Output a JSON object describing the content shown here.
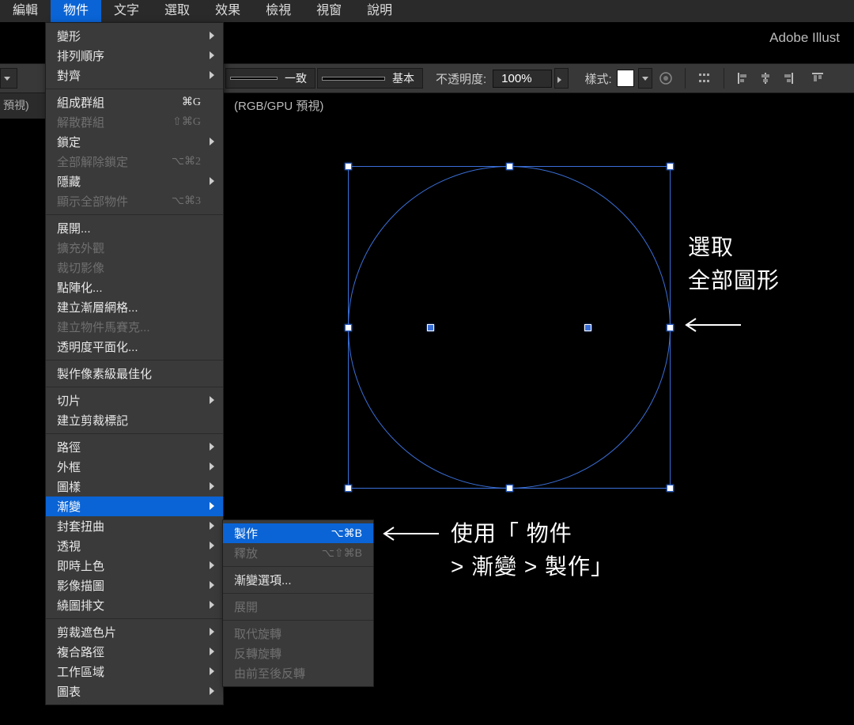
{
  "app_name": "Adobe Illust",
  "menubar": [
    "編輯",
    "物件",
    "文字",
    "選取",
    "效果",
    "檢視",
    "視窗",
    "說明"
  ],
  "menubar_active_index": 1,
  "controlbar": {
    "stroke_style_label_1": "一致",
    "stroke_style_label_2": "基本",
    "opacity_label": "不透明度:",
    "opacity_value": "100%",
    "style_label": "樣式:"
  },
  "tab_stub": "預視)",
  "doc_tab_suffix": "(RGB/GPU 預視)",
  "object_menu": {
    "groups": [
      [
        {
          "label": "變形",
          "arrow": true
        },
        {
          "label": "排列順序",
          "arrow": true
        },
        {
          "label": "對齊",
          "arrow": true
        }
      ],
      [
        {
          "label": "組成群組",
          "shortcut": "⌘G"
        },
        {
          "label": "解散群組",
          "shortcut": "⇧⌘G",
          "disabled": true
        },
        {
          "label": "鎖定",
          "arrow": true
        },
        {
          "label": "全部解除鎖定",
          "shortcut": "⌥⌘2",
          "disabled": true
        },
        {
          "label": "隱藏",
          "arrow": true
        },
        {
          "label": "顯示全部物件",
          "shortcut": "⌥⌘3",
          "disabled": true
        }
      ],
      [
        {
          "label": "展開..."
        },
        {
          "label": "擴充外觀",
          "disabled": true
        },
        {
          "label": "裁切影像",
          "disabled": true
        },
        {
          "label": "點陣化..."
        },
        {
          "label": "建立漸層網格..."
        },
        {
          "label": "建立物件馬賽克...",
          "disabled": true
        },
        {
          "label": "透明度平面化..."
        }
      ],
      [
        {
          "label": "製作像素級最佳化"
        }
      ],
      [
        {
          "label": "切片",
          "arrow": true
        },
        {
          "label": "建立剪裁標記"
        }
      ],
      [
        {
          "label": "路徑",
          "arrow": true
        },
        {
          "label": "外框",
          "arrow": true
        },
        {
          "label": "圖樣",
          "arrow": true
        },
        {
          "label": "漸變",
          "arrow": true,
          "highlight": true
        },
        {
          "label": "封套扭曲",
          "arrow": true
        },
        {
          "label": "透視",
          "arrow": true
        },
        {
          "label": "即時上色",
          "arrow": true
        },
        {
          "label": "影像描圖",
          "arrow": true
        },
        {
          "label": "繞圖排文",
          "arrow": true
        }
      ],
      [
        {
          "label": "剪裁遮色片",
          "arrow": true
        },
        {
          "label": "複合路徑",
          "arrow": true
        },
        {
          "label": "工作區域",
          "arrow": true
        },
        {
          "label": "圖表",
          "arrow": true
        }
      ]
    ]
  },
  "blend_submenu": [
    {
      "label": "製作",
      "shortcut": "⌥⌘B",
      "highlight": true
    },
    {
      "label": "釋放",
      "shortcut": "⌥⇧⌘B",
      "disabled": true
    },
    {
      "sep": true
    },
    {
      "label": "漸變選項..."
    },
    {
      "sep": true
    },
    {
      "label": "展開",
      "disabled": true
    },
    {
      "sep": true
    },
    {
      "label": "取代旋轉",
      "disabled": true
    },
    {
      "label": "反轉旋轉",
      "disabled": true
    },
    {
      "label": "由前至後反轉",
      "disabled": true
    }
  ],
  "annotations": {
    "select_line1": "選取",
    "select_line2": "全部圖形",
    "use_line1": "使用「 物件",
    "use_line2": " > 漸變 > 製作」"
  }
}
